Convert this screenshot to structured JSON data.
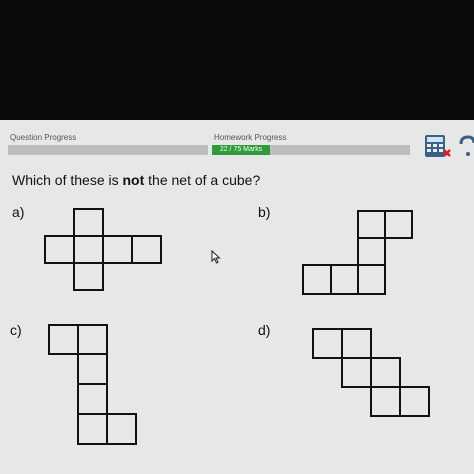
{
  "header": {
    "question_progress_label": "Question Progress",
    "question_progress_value": 0.0,
    "homework_progress_label": "Homework Progress",
    "homework_progress_text": "22 / 75 Marks",
    "homework_progress_value": 0.2933
  },
  "toolbar": {
    "calculator_icon": "calculator-icon",
    "help_icon": "help-icon"
  },
  "question": {
    "prefix": "Which of these is ",
    "emphasis": "not",
    "suffix": " the net of a cube?"
  },
  "options": [
    {
      "label": "a)"
    },
    {
      "label": "b)"
    },
    {
      "label": "c)"
    },
    {
      "label": "d)"
    }
  ],
  "colors": {
    "progress_fill": "#2f9b3b",
    "background": "#e7e7e7",
    "ink": "#111111"
  }
}
